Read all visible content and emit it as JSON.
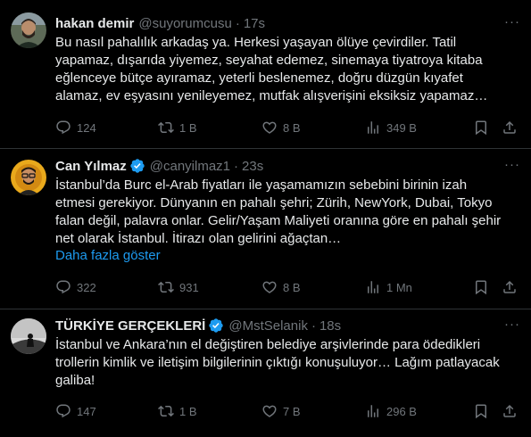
{
  "tweets": [
    {
      "name": "hakan demir",
      "handle": "@suyorumcusu",
      "separator": "·",
      "time": "17s",
      "verified": false,
      "lines": [
        "Bu nasıl pahalılık arkadaş ya. Herkesi yaşayan ölüye çevirdiler. Tatil",
        "yapamaz, dışarıda yiyemez, seyahat edemez, sinemaya tiyatroya kitaba",
        "eğlenceye bütçe ayıramaz, yeterli beslenemez, doğru düzgün kıyafet",
        "alamaz, ev eşyasını yenileyemez, mutfak alışverişini eksiksiz yapamaz…"
      ],
      "show_more": "",
      "replies": "124",
      "reposts": "1 B",
      "likes": "8 B",
      "views": "349 B"
    },
    {
      "name": "Can Yılmaz",
      "handle": "@canyilmaz1",
      "separator": "·",
      "time": "23s",
      "verified": true,
      "lines": [
        "İstanbul’da Burc el-Arab fiyatları ile yaşamamızın sebebini birinin izah",
        "etmesi gerekiyor. Dünyanın en pahalı şehri; Zürih, NewYork, Dubai, Tokyo",
        "falan değil, palavra onlar.  Gelir/Yaşam Maliyeti oranına göre en pahalı şehir",
        "net olarak İstanbul. İtirazı olan gelirini ağaçtan…"
      ],
      "show_more": "Daha fazla göster",
      "replies": "322",
      "reposts": "931",
      "likes": "8 B",
      "views": "1 Mn"
    },
    {
      "name": "TÜRKİYE GERÇEKLERİ",
      "handle": "@MstSelanik",
      "separator": "·",
      "time": "18s",
      "verified": true,
      "lines": [
        "İstanbul ve Ankara’nın el değiştiren belediye arşivlerinde para ödedikleri",
        "trollerin kimlik ve iletişim bilgilerinin çıktığı konuşuluyor… Lağım patlayacak",
        "galiba!"
      ],
      "show_more": "",
      "replies": "147",
      "reposts": "1 B",
      "likes": "7 B",
      "views": "296 B"
    }
  ],
  "more_glyph": "···",
  "colors": {
    "background": "#000000",
    "text": "#e7e9ea",
    "muted": "#71767b",
    "link": "#1d9bf0",
    "divider": "#2f3336",
    "verified": "#1d9bf0"
  }
}
